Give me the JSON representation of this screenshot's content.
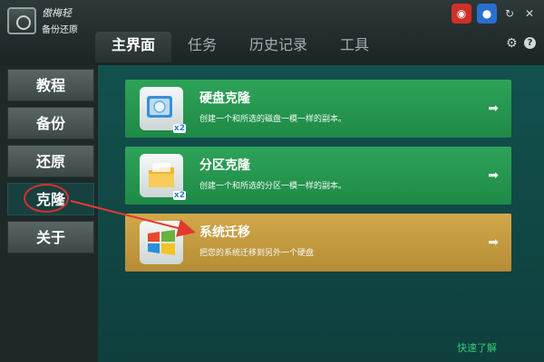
{
  "app": {
    "brand_line1": "傲梅轻",
    "brand_line2": "备份还原"
  },
  "nav": {
    "tabs": [
      "主界面",
      "任务",
      "历史记录",
      "工具"
    ],
    "active_index": 0
  },
  "window_controls": {
    "weibo_icon": "weibo-icon",
    "qq_icon": "qq-icon",
    "refresh_icon": "refresh-icon",
    "close_icon": "close-icon",
    "settings_icon": "gear-icon",
    "help_icon": "help-icon"
  },
  "sidebar": {
    "items": [
      {
        "label": "教程"
      },
      {
        "label": "备份"
      },
      {
        "label": "还原"
      },
      {
        "label": "克隆"
      },
      {
        "label": "关于"
      }
    ],
    "active_index": 3
  },
  "cards": [
    {
      "title": "硬盘克隆",
      "desc": "创建一个和所选的磁盘一模一样的副本。",
      "icon": "disk-clone-icon",
      "color": "#2ea358"
    },
    {
      "title": "分区克隆",
      "desc": "创建一个和所选的分区一模一样的副本。",
      "icon": "partition-clone-icon",
      "color": "#2ea358"
    },
    {
      "title": "系统迁移",
      "desc": "把您的系统迁移到另外一个硬盘",
      "icon": "windows-logo-icon",
      "color": "#d2a84a"
    }
  ],
  "footer": {
    "link": "快速了解"
  }
}
